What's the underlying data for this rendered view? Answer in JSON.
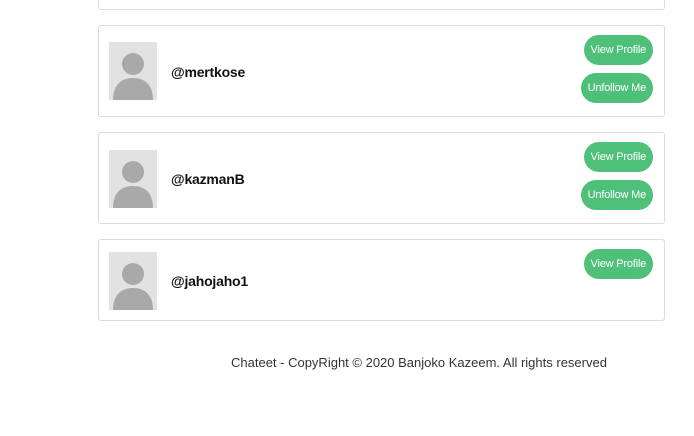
{
  "users": [
    {
      "username": "@mertkose",
      "view_label": "View Profile",
      "unfollow_label": "Unfollow Me"
    },
    {
      "username": "@kazmanB",
      "view_label": "View Profile",
      "unfollow_label": "Unfollow Me"
    },
    {
      "username": "@jahojaho1",
      "view_label": "View Profile"
    }
  ],
  "footer": {
    "text": "Chateet - CopyRight © 2020 Banjoko Kazeem. All rights reserved"
  },
  "colors": {
    "button": "#4ec07a",
    "avatar_bg": "#e2e2e2",
    "avatar_fg": "#a9a9a9",
    "card_border": "#dcdcdc"
  },
  "icons": {
    "avatar": "default-user-avatar"
  }
}
